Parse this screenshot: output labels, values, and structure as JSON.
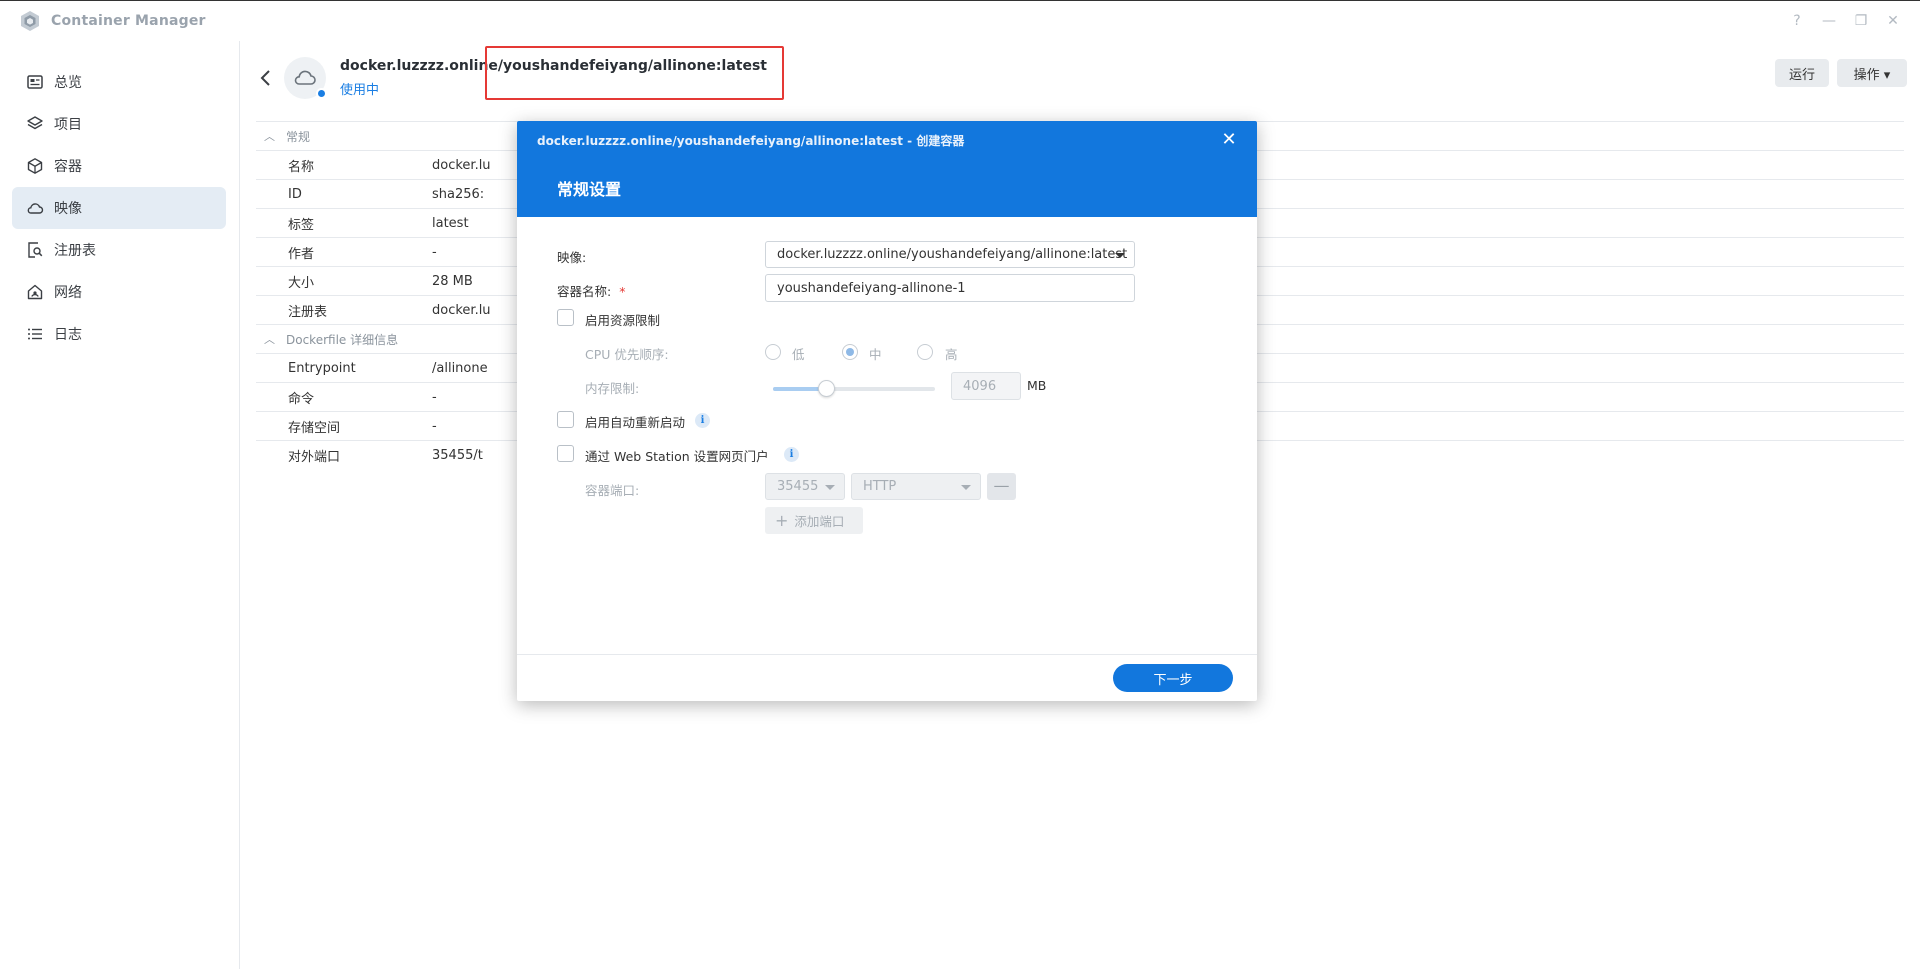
{
  "app": {
    "title": "Container Manager",
    "icon": "container-manager-logo"
  },
  "window_controls": [
    {
      "name": "help-icon",
      "glyph": "?"
    },
    {
      "name": "minimize-icon",
      "glyph": "—"
    },
    {
      "name": "restore-icon",
      "glyph": "❐"
    },
    {
      "name": "close-icon",
      "glyph": "✕"
    }
  ],
  "sidebar": {
    "items": [
      {
        "label": "总览",
        "icon": "overview-icon",
        "active": false
      },
      {
        "label": "项目",
        "icon": "layers-icon",
        "active": false
      },
      {
        "label": "容器",
        "icon": "cube-icon",
        "active": false
      },
      {
        "label": "映像",
        "icon": "cloud-icon",
        "active": true
      },
      {
        "label": "注册表",
        "icon": "registry-search-icon",
        "active": false
      },
      {
        "label": "网络",
        "icon": "network-home-icon",
        "active": false
      },
      {
        "label": "日志",
        "icon": "list-icon",
        "active": false
      }
    ]
  },
  "header": {
    "image_name": "docker.luzzzz.online/youshandefeiyang/allinone:latest",
    "status": "使用中",
    "run_label": "运行",
    "action_label": "操作 ▾"
  },
  "details": {
    "general_title": "常规",
    "general_rows": [
      {
        "label": "名称",
        "value": "docker.lu"
      },
      {
        "label": "ID",
        "value": "sha256:"
      },
      {
        "label": "标签",
        "value": "latest"
      },
      {
        "label": "作者",
        "value": "-"
      },
      {
        "label": "大小",
        "value": "28 MB"
      },
      {
        "label": "注册表",
        "value": "docker.lu"
      }
    ],
    "dockerfile_title": "Dockerfile 详细信息",
    "dockerfile_rows": [
      {
        "label": "Entrypoint",
        "value": "/allinone"
      },
      {
        "label": "命令",
        "value": "-"
      },
      {
        "label": "存储空间",
        "value": "-"
      },
      {
        "label": "对外端口",
        "value": "35455/t"
      }
    ]
  },
  "dialog": {
    "title": "docker.luzzzz.online/youshandefeiyang/allinone:latest - 创建容器",
    "subtitle": "常规设置",
    "image_label": "映像:",
    "image_value": "docker.luzzzz.online/youshandefeiyang/allinone:latest",
    "container_name_label": "容器名称:",
    "container_name_required": "*",
    "container_name_value": "youshandefeiyang-allinone-1",
    "resource_limit_label": "启用资源限制",
    "cpu_priority_label": "CPU 优先顺序:",
    "cpu_options": [
      "低",
      "中",
      "高"
    ],
    "cpu_selected": "中",
    "memory_limit_label": "内存限制:",
    "memory_value": "4096",
    "memory_unit": "MB",
    "memory_slider_fraction": 0.33,
    "auto_restart_label": "启用自动重新启动",
    "web_station_label": "通过 Web Station 设置网页门户",
    "container_port_label": "容器端口:",
    "port_value": "35455",
    "protocol_value": "HTTP",
    "remove_port_glyph": "—",
    "add_port_label": "添加端口",
    "next_button": "下一步",
    "close_glyph": "✕"
  },
  "colors": {
    "accent": "#1277dd",
    "highlight": "#e53935",
    "sidebar_active": "#e4ecf4"
  }
}
